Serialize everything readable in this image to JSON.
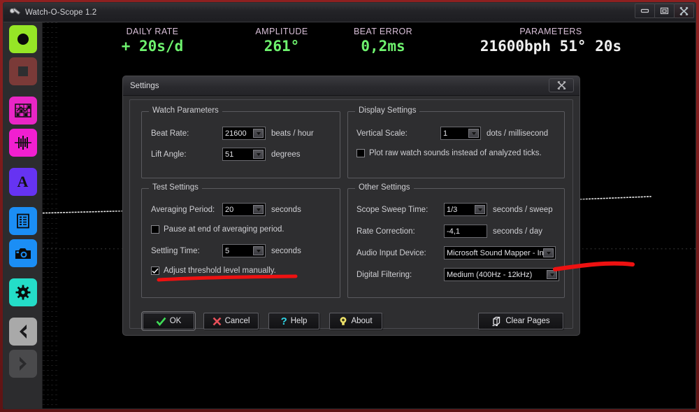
{
  "window": {
    "title": "Watch-O-Scope 1.2",
    "icon": "watch-icon",
    "buttons": {
      "minimize": "minimize-icon",
      "maximize": "maximize-icon",
      "close": "close-icon"
    }
  },
  "sidebar": {
    "items": [
      {
        "name": "record-button",
        "icon": "record-circle-icon"
      },
      {
        "name": "stop-button",
        "icon": "stop-square-icon"
      },
      {
        "name": "grid-view-button",
        "icon": "grid-chart-icon"
      },
      {
        "name": "waveform-button",
        "icon": "waveform-icon"
      },
      {
        "name": "annotate-text-button",
        "icon": "letter-a-icon"
      },
      {
        "name": "list-report-button",
        "icon": "list-icon"
      },
      {
        "name": "snapshot-button",
        "icon": "camera-icon"
      },
      {
        "name": "settings-button",
        "icon": "gear-icon"
      },
      {
        "name": "previous-page-button",
        "icon": "chevron-left-icon"
      },
      {
        "name": "next-page-button",
        "icon": "chevron-right-icon"
      }
    ]
  },
  "readout": {
    "stats": [
      {
        "label": "DAILY RATE",
        "value": "+ 20s/d"
      },
      {
        "label": "AMPLITUDE",
        "value": "261°"
      },
      {
        "label": "BEAT ERROR",
        "value": "0,2ms"
      },
      {
        "label": "PARAMETERS",
        "value": "21600bph 51° 20s"
      }
    ]
  },
  "dialog": {
    "title": "Settings",
    "close_icon": "close-icon",
    "watch_parameters": {
      "legend": "Watch Parameters",
      "beat_rate": {
        "label": "Beat Rate:",
        "accel": "R",
        "value": "21600",
        "unit": "beats / hour"
      },
      "lift_angle": {
        "label": "Lift Angle:",
        "accel": "A",
        "value": "51",
        "unit": "degrees"
      }
    },
    "display_settings": {
      "legend": "Display Settings",
      "vertical_scale": {
        "label": "Vertical Scale:",
        "accel": "V",
        "value": "1",
        "unit": "dots / millisecond"
      },
      "plot_raw": {
        "label": "Plot raw watch sounds instead of analyzed ticks.",
        "checked": false
      }
    },
    "test_settings": {
      "legend": "Test Settings",
      "averaging_period": {
        "label": "Averaging Period:",
        "accel": "P",
        "value": "20",
        "unit": "seconds"
      },
      "pause_at_end": {
        "label": "Pause at end of averaging period.",
        "checked": false
      },
      "settling_time": {
        "label": "Settling Time:",
        "accel": "T",
        "value": "5",
        "unit": "seconds"
      },
      "adjust_threshold": {
        "label": "Adjust threshold level manually.",
        "checked": true
      }
    },
    "other_settings": {
      "legend": "Other Settings",
      "scope_sweep_time": {
        "label": "Scope Sweep Time:",
        "accel": "w",
        "value": "1/3",
        "unit": "seconds / sweep"
      },
      "rate_correction": {
        "label": "Rate Correction:",
        "accel": "C",
        "value": "-4,1",
        "unit": "seconds / day"
      },
      "audio_input_device": {
        "label": "Audio Input Device:",
        "accel": "D",
        "value": "Microsoft Sound Mapper - Inpu"
      },
      "digital_filtering": {
        "label": "Digital Filtering:",
        "accel": "F",
        "value": "Medium (400Hz - 12kHz)"
      }
    },
    "buttons": {
      "ok": {
        "label": "OK",
        "icon": "check-icon"
      },
      "cancel": {
        "label": "Cancel",
        "icon": "x-icon"
      },
      "help": {
        "label": "Help",
        "icon": "question-icon"
      },
      "about": {
        "label": "About",
        "icon": "info-bulb-icon"
      },
      "clear_pages": {
        "label": "Clear Pages",
        "icon": "eraser-icon"
      }
    }
  },
  "annotations": {
    "color": "#ee1111",
    "marks": [
      "underline-adjust-threshold",
      "arrow-to-digital-filtering"
    ]
  },
  "colors": {
    "accent_green": "#6ef26e",
    "label_pink": "#d9c0d8",
    "frame_red": "#8e2020",
    "dialog_bg": "#2e2e30",
    "record_green": "#96e626",
    "magenta": "#e926c6",
    "blue": "#1b8ef5",
    "teal": "#24ddc8",
    "violet": "#6633f2"
  }
}
